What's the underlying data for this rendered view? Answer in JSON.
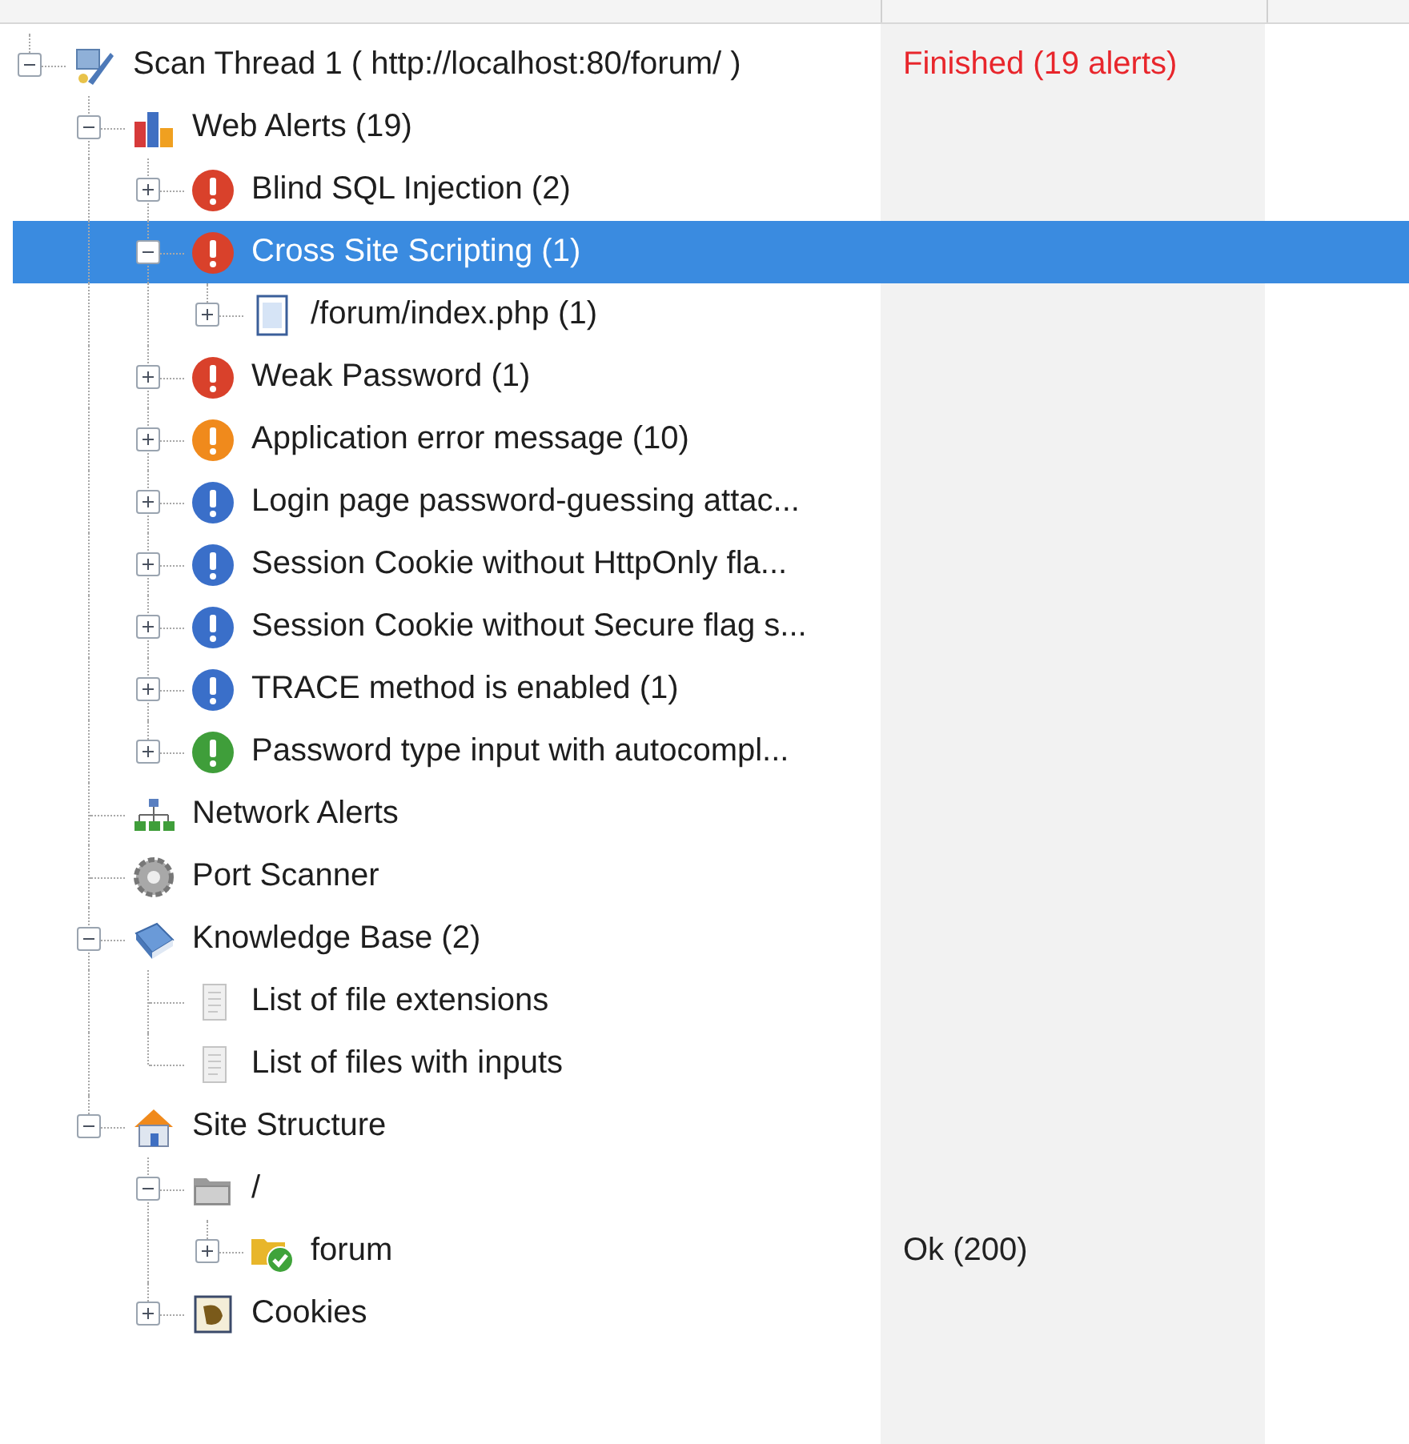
{
  "tree": [
    {
      "label": "Scan Thread 1 ( http://localhost:80/forum/ )",
      "kind": "scan-thread",
      "expanded": true,
      "selected": false,
      "status": {
        "text": "Finished (19 alerts)",
        "color": "#e8262c"
      },
      "children": [
        {
          "label": "Web Alerts (19)",
          "kind": "web-alerts",
          "expanded": true,
          "selected": false,
          "children": [
            {
              "label": "Blind SQL Injection (2)",
              "kind": "alert",
              "color": "#d9412b",
              "expanded": false,
              "selected": false
            },
            {
              "label": "Cross Site Scripting (1)",
              "kind": "alert",
              "color": "#d9412b",
              "expanded": true,
              "selected": true,
              "children": [
                {
                  "label": "/forum/index.php (1)",
                  "kind": "page",
                  "expanded": false,
                  "selected": false
                }
              ]
            },
            {
              "label": "Weak Password (1)",
              "kind": "alert",
              "color": "#d9412b",
              "expanded": false,
              "selected": false
            },
            {
              "label": "Application error message (10)",
              "kind": "alert",
              "color": "#f08a1c",
              "expanded": false,
              "selected": false
            },
            {
              "label": "Login page password-guessing attac...",
              "kind": "alert",
              "color": "#3a6fc9",
              "expanded": false,
              "selected": false
            },
            {
              "label": "Session Cookie without HttpOnly fla...",
              "kind": "alert",
              "color": "#3a6fc9",
              "expanded": false,
              "selected": false
            },
            {
              "label": "Session Cookie without Secure flag s...",
              "kind": "alert",
              "color": "#3a6fc9",
              "expanded": false,
              "selected": false
            },
            {
              "label": "TRACE method is enabled (1)",
              "kind": "alert",
              "color": "#3a6fc9",
              "expanded": false,
              "selected": false
            },
            {
              "label": "Password type input with autocompl...",
              "kind": "alert",
              "color": "#3f9e3a",
              "expanded": false,
              "selected": false
            }
          ]
        },
        {
          "label": "Network Alerts",
          "kind": "network-alerts",
          "selected": false
        },
        {
          "label": "Port Scanner",
          "kind": "port-scanner",
          "selected": false
        },
        {
          "label": "Knowledge Base (2)",
          "kind": "knowledge-base",
          "expanded": true,
          "selected": false,
          "children": [
            {
              "label": "List of file extensions",
              "kind": "list",
              "selected": false
            },
            {
              "label": "List of files with inputs",
              "kind": "list",
              "selected": false
            }
          ]
        },
        {
          "label": "Site Structure",
          "kind": "site-structure",
          "expanded": true,
          "selected": false,
          "children": [
            {
              "label": "/",
              "kind": "folder",
              "expanded": true,
              "selected": false,
              "children": [
                {
                  "label": "forum",
                  "kind": "folder-ok",
                  "expanded": false,
                  "selected": false,
                  "status": {
                    "text": "Ok (200)",
                    "color": "#222222"
                  }
                }
              ]
            },
            {
              "label": "Cookies",
              "kind": "cookies",
              "expanded": false,
              "selected": false
            }
          ]
        }
      ]
    }
  ]
}
